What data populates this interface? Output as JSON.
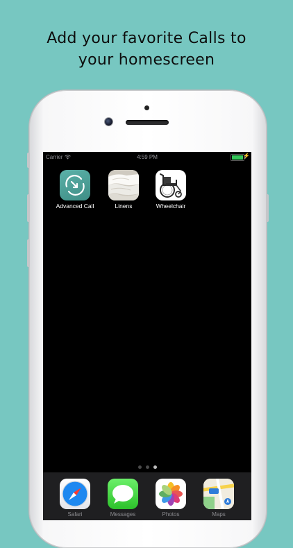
{
  "headline": {
    "line1": "Add your favorite Calls to",
    "line2": "your homescreen"
  },
  "colors": {
    "background": "#77c7c1",
    "screen": "#000000",
    "battery": "#35c75a"
  },
  "status_bar": {
    "carrier": "Carrier",
    "time": "4:59 PM",
    "wifi_icon": "wifi-icon",
    "battery_icon": "battery-icon",
    "charging_icon": "bolt-icon"
  },
  "home_apps": [
    {
      "label": "Advanced Call",
      "icon": "advanced-call-icon"
    },
    {
      "label": "Linens",
      "icon": "linens-icon"
    },
    {
      "label": "Wheelchair",
      "icon": "wheelchair-icon"
    }
  ],
  "page_indicator": {
    "count": 3,
    "active": 2
  },
  "dock_apps": [
    {
      "label": "Safari",
      "icon": "safari-icon"
    },
    {
      "label": "Messages",
      "icon": "messages-icon"
    },
    {
      "label": "Photos",
      "icon": "photos-icon"
    },
    {
      "label": "Maps",
      "icon": "maps-icon"
    }
  ]
}
